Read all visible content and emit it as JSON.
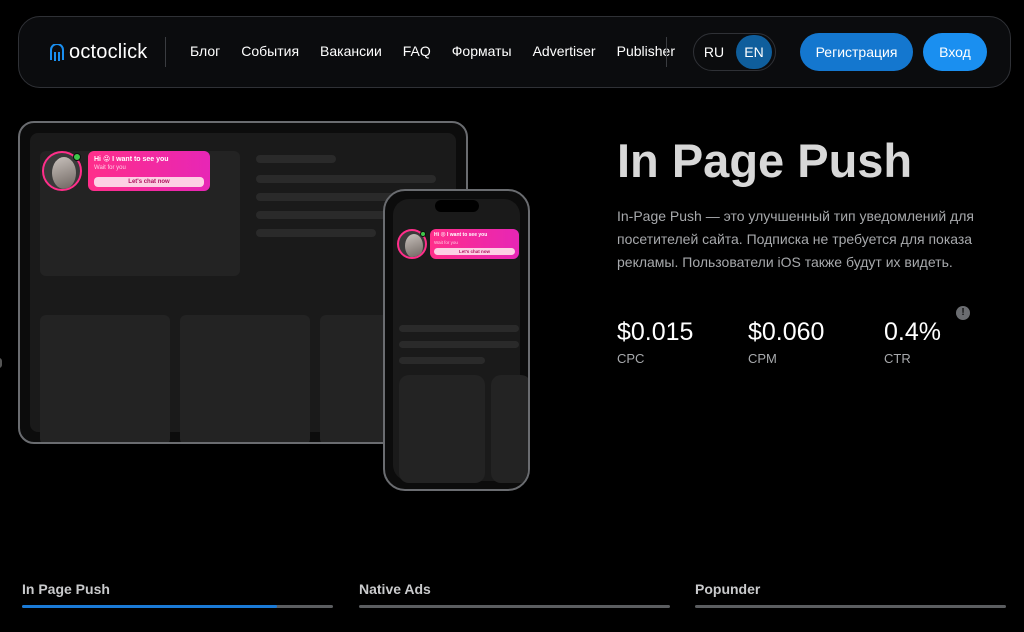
{
  "header": {
    "logo_text": "octoclick",
    "menu": [
      "Блог",
      "События",
      "Вакансии",
      "FAQ",
      "Форматы",
      "Advertiser",
      "Publisher"
    ],
    "languages": {
      "ru": "RU",
      "en": "EN",
      "active": "EN"
    },
    "register_label": "Регистрация",
    "login_label": "Вход"
  },
  "preview": {
    "tablet_notification": {
      "title": "Hi 😜 I want to see you",
      "subtitle": "Wait for you",
      "button": "Let's chat now"
    },
    "phone_notification": {
      "title": "Hi 😜 I want to see you",
      "subtitle": "Wait for you",
      "button": "Let's chat now"
    }
  },
  "hero": {
    "title": "In Page Push",
    "description": "In-Page Push — это улучшенный тип уведомлений для посетителей сайта. Подписка не требуется для показа рекламы. Пользователи iOS также будут их видеть.",
    "stats": [
      {
        "value": "$0.015",
        "label": "CPC"
      },
      {
        "value": "$0.060",
        "label": "CPM"
      },
      {
        "value": "0.4%",
        "label": "CTR"
      }
    ],
    "info_icon": "!"
  },
  "tabs": [
    {
      "label": "In Page Push",
      "progress": 0.82,
      "active": true
    },
    {
      "label": "Native Ads",
      "progress": 0,
      "active": false
    },
    {
      "label": "Popunder",
      "progress": 0,
      "active": false
    }
  ],
  "colors": {
    "accent": "#1a7ad6",
    "notification_pink": "#ff2e8a",
    "online": "#3ec64a"
  }
}
